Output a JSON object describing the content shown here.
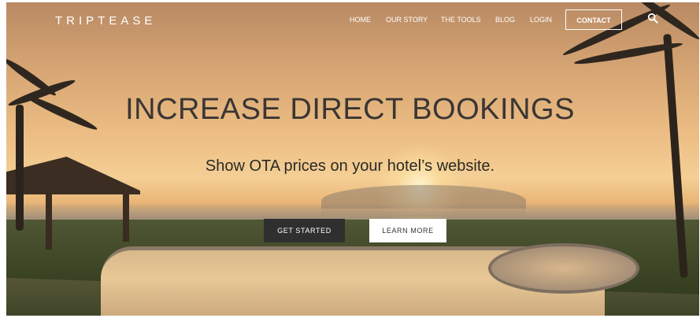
{
  "brand": {
    "logo_text": "TRIPTEASE"
  },
  "nav": {
    "items": [
      {
        "label": "HOME"
      },
      {
        "label": "OUR STORY"
      },
      {
        "label": "THE TOOLS"
      },
      {
        "label": "BLOG"
      },
      {
        "label": "LOGIN"
      }
    ],
    "contact_label": "CONTACT",
    "search_icon": "search-icon"
  },
  "hero": {
    "headline": "INCREASE DIRECT BOOKINGS",
    "subheadline": "Show OTA prices on your hotel’s website.",
    "primary_cta": "GET STARTED",
    "secondary_cta": "LEARN MORE"
  },
  "colors": {
    "primary_button_bg": "#2f2f2f",
    "secondary_button_bg": "#ffffff",
    "nav_text": "#ffffff",
    "headline_text": "#3a3633"
  }
}
